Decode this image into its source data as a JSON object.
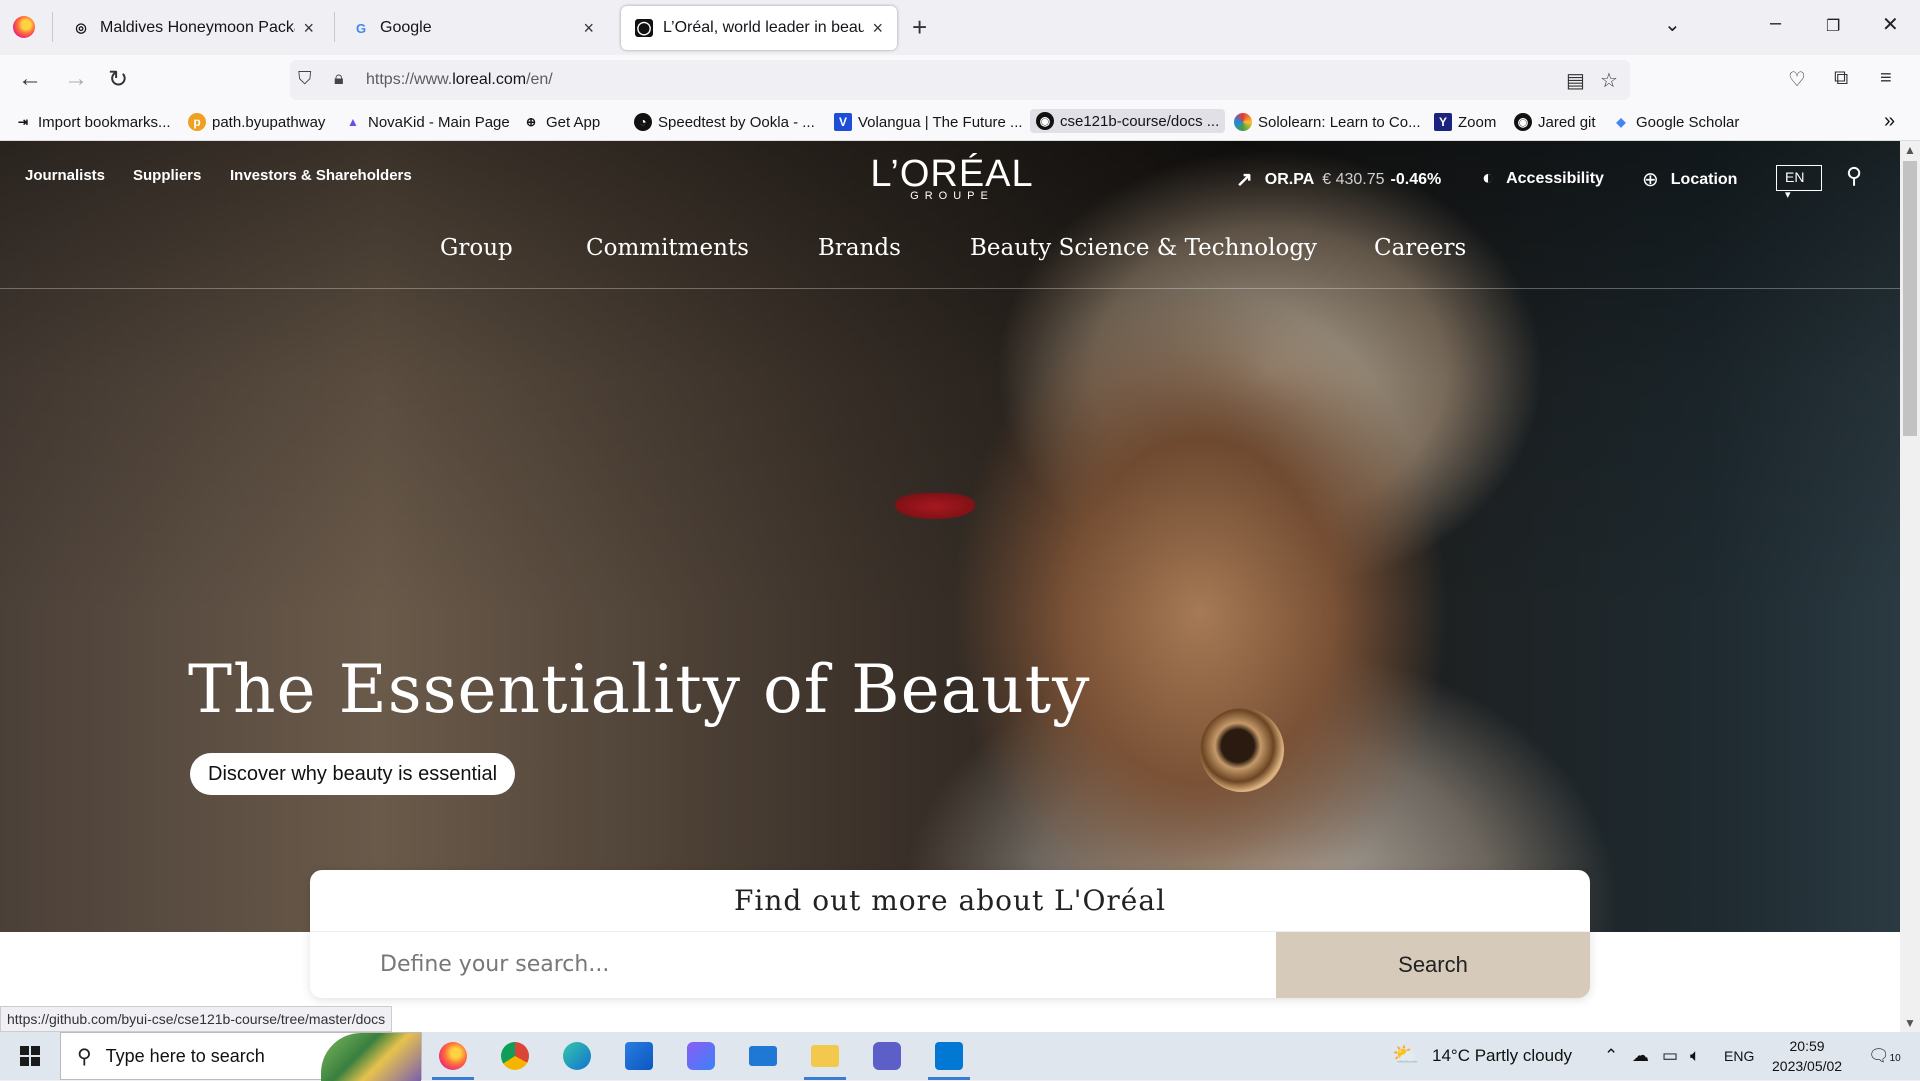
{
  "browser": {
    "tabs": [
      {
        "title": "Maldives Honeymoon Packages",
        "active": false
      },
      {
        "title": "Google",
        "active": false
      },
      {
        "title": "L’Oréal, world leader in beauty",
        "active": true
      }
    ],
    "url_prefix": "https://www.",
    "url_domain": "loreal.com",
    "url_path": "/en/",
    "bookmarks": [
      "Import bookmarks...",
      "path.byupathway",
      "NovaKid - Main Page",
      "Get App",
      "Speedtest by Ookla - ...",
      "Volangua | The Future ...",
      "cse121b-course/docs ...",
      "Sololearn: Learn to Co...",
      "Zoom",
      "Jared git",
      "Google Scholar"
    ],
    "status_url": "https://github.com/byui-cse/cse121b-course/tree/master/docs"
  },
  "site": {
    "top_links": [
      "Journalists",
      "Suppliers",
      "Investors & Shareholders"
    ],
    "logo_main": "L’ORÉAL",
    "logo_sub": "GROUPE",
    "stock_symbol": "OR.PA",
    "stock_price": "€ 430.75",
    "stock_change": "-0.46%",
    "accessibility": "Accessibility",
    "location": "Location",
    "language": "EN",
    "main_nav": [
      "Group",
      "Commitments",
      "Brands",
      "Beauty Science & Technology",
      "Careers"
    ],
    "headline": "The Essentiality of Beauty",
    "cta": "Discover why beauty is essential",
    "find_title": "Find out more about L'Oréal",
    "search_placeholder": "Define your search...",
    "search_button": "Search"
  },
  "taskbar": {
    "search_placeholder": "Type here to search",
    "weather": "14°C  Partly cloudy",
    "lang": "ENG",
    "time": "20:59",
    "date": "2023/05/02",
    "notifications": "10"
  },
  "colors": {
    "search_button_bg": "#d6cabb",
    "taskbar_bg": "#dfe6ee",
    "accent": "#3a7bd5"
  }
}
